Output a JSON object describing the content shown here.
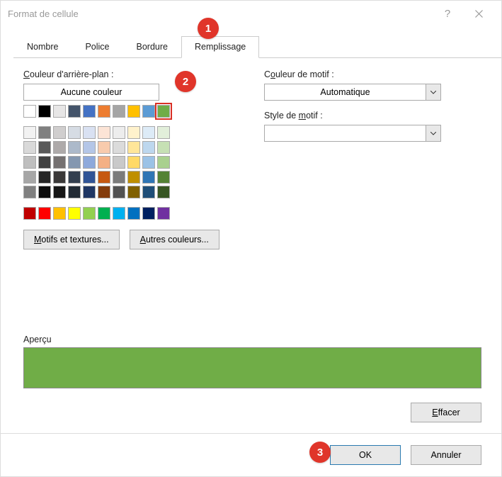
{
  "title": "Format de cellule",
  "tabs": [
    "Nombre",
    "Police",
    "Bordure",
    "Remplissage"
  ],
  "active_tab": 3,
  "labels": {
    "bg_color": "Couleur d'arrière-plan :",
    "no_color": "Aucune couleur",
    "patterns_btn": "Motifs et textures...",
    "more_colors_btn": "Autres couleurs...",
    "pattern_color": "Couleur de motif :",
    "pattern_color_val": "Automatique",
    "pattern_style": "Style de motif :",
    "pattern_style_val": "",
    "preview": "Aperçu",
    "clear": "Effacer",
    "ok": "OK",
    "cancel": "Annuler"
  },
  "preview_color": "#70AD47",
  "callouts": [
    "1",
    "2",
    "3"
  ],
  "theme_row1": [
    "#FFFFFF",
    "#000000",
    "#E7E6E6",
    "#44546A",
    "#4472C4",
    "#ED7D31",
    "#A5A5A5",
    "#FFC000",
    "#5B9BD5",
    "#70AD47"
  ],
  "theme_shades": [
    [
      "#F2F2F2",
      "#808080",
      "#D0CECE",
      "#D6DCE4",
      "#D9E1F2",
      "#FCE4D6",
      "#EDEDED",
      "#FFF2CC",
      "#DDEBF7",
      "#E2EFDA"
    ],
    [
      "#D9D9D9",
      "#595959",
      "#AEAAAA",
      "#ACB9CA",
      "#B4C6E7",
      "#F8CBAD",
      "#DBDBDB",
      "#FFE699",
      "#BDD7EE",
      "#C6E0B4"
    ],
    [
      "#BFBFBF",
      "#404040",
      "#757171",
      "#8497B0",
      "#8EA9DB",
      "#F4B084",
      "#C9C9C9",
      "#FFD966",
      "#9BC2E6",
      "#A9D08E"
    ],
    [
      "#A6A6A6",
      "#262626",
      "#3A3838",
      "#333F4F",
      "#305496",
      "#C65911",
      "#7B7B7B",
      "#BF8F00",
      "#2F75B5",
      "#548235"
    ],
    [
      "#808080",
      "#0D0D0D",
      "#161616",
      "#222B35",
      "#203764",
      "#833C0C",
      "#525252",
      "#806000",
      "#1F4E78",
      "#375623"
    ]
  ],
  "standard": [
    "#C00000",
    "#FF0000",
    "#FFC000",
    "#FFFF00",
    "#92D050",
    "#00B050",
    "#00B0F0",
    "#0070C0",
    "#002060",
    "#7030A0"
  ]
}
